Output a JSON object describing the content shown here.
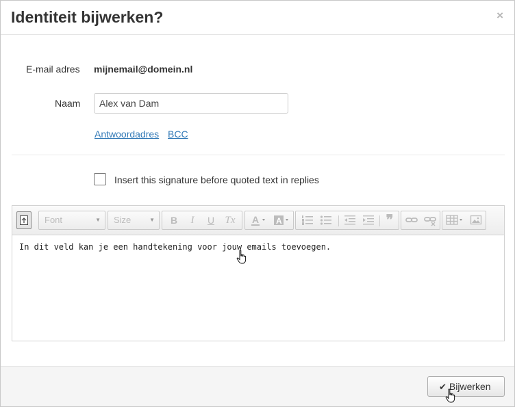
{
  "dialog": {
    "title": "Identiteit bijwerken?",
    "close_label": "×"
  },
  "form": {
    "email_label": "E-mail adres",
    "email_value": "mijnemail@domein.nl",
    "name_label": "Naam",
    "name_value": "Alex van Dam",
    "links": {
      "reply_to": "Antwoordadres",
      "bcc": "BCC"
    },
    "signature_checkbox_label": "Insert this signature before quoted text in replies",
    "signature_checkbox_checked": false
  },
  "editor": {
    "font_placeholder": "Font",
    "size_placeholder": "Size",
    "buttons": {
      "bold": "B",
      "italic": "I",
      "underline": "U",
      "remove_format": "Tx",
      "blockquote": "❞"
    },
    "content": "In dit veld kan je een handtekening voor jouw emails toevoegen."
  },
  "footer": {
    "submit_icon": "check-icon",
    "submit_label": "Bijwerken"
  },
  "colors": {
    "link": "#337ab7",
    "footer_bg": "#f5f5f5",
    "toolbar_icon": "#bcbcbc"
  }
}
